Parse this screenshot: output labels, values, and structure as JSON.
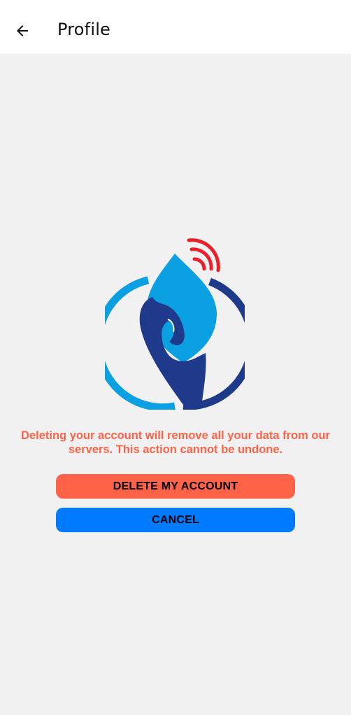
{
  "header": {
    "title": "Profile",
    "back_icon": "arrow-left-icon"
  },
  "logo": {
    "icon": "water-drop-hand-signal-logo",
    "colors": {
      "drop": "#0aa0e2",
      "ring_light": "#0aa0e2",
      "ring_dark": "#1f3a8a",
      "signal": "#e8202a"
    }
  },
  "warning": {
    "text": "Deleting your account will remove all your data from our servers. This action cannot be undone.",
    "color": "#ff6347"
  },
  "actions": {
    "delete_label": "DELETE MY ACCOUNT",
    "cancel_label": "CANCEL",
    "delete_color": "#ff6347",
    "cancel_color": "#007bff"
  }
}
